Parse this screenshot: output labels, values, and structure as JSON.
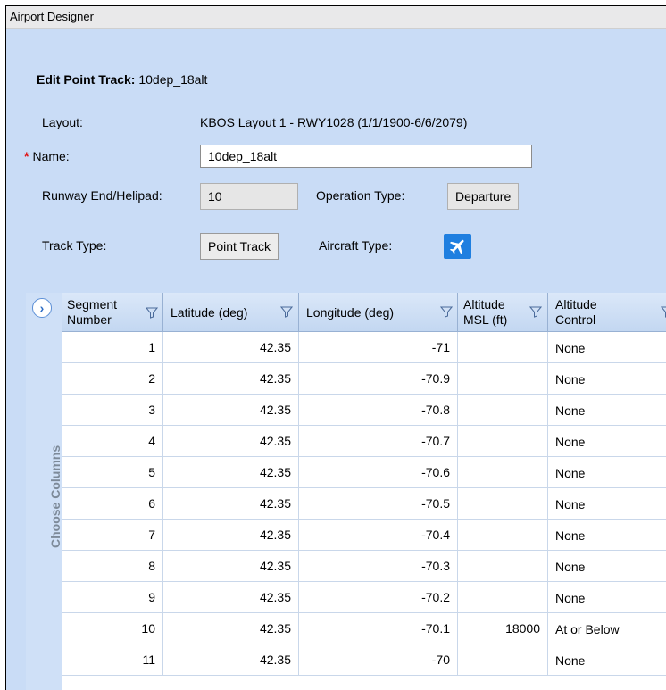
{
  "window": {
    "title": "Airport Designer"
  },
  "form": {
    "heading_label": "Edit Point Track:",
    "heading_value": "10dep_18alt",
    "layout_label": "Layout:",
    "layout_value": "KBOS Layout 1 - RWY1028 (1/1/1900-6/6/2079)",
    "required_marker": "*",
    "name_label": "Name:",
    "name_value": "10dep_18alt",
    "runway_label": "Runway End/Helipad:",
    "runway_value": "10",
    "operation_label": "Operation Type:",
    "operation_value": "Departure",
    "track_type_label": "Track Type:",
    "track_type_value": "Point Track",
    "aircraft_type_label": "Aircraft Type:",
    "aircraft_icon": "airplane-icon"
  },
  "side_panel": {
    "expand_icon": "chevron-right-icon",
    "choose_columns_label": "Choose Columns"
  },
  "grid": {
    "columns": [
      {
        "line1": "Segment",
        "line2": "Number"
      },
      {
        "line1": "Latitude (deg)",
        "line2": ""
      },
      {
        "line1": "Longitude (deg)",
        "line2": ""
      },
      {
        "line1": "Altitude",
        "line2": "MSL (ft)"
      },
      {
        "line1": "Altitude",
        "line2": "Control"
      }
    ],
    "rows": [
      {
        "segment": "1",
        "lat": "42.35",
        "lon": "-71",
        "alt": "",
        "control": "None"
      },
      {
        "segment": "2",
        "lat": "42.35",
        "lon": "-70.9",
        "alt": "",
        "control": "None"
      },
      {
        "segment": "3",
        "lat": "42.35",
        "lon": "-70.8",
        "alt": "",
        "control": "None"
      },
      {
        "segment": "4",
        "lat": "42.35",
        "lon": "-70.7",
        "alt": "",
        "control": "None"
      },
      {
        "segment": "5",
        "lat": "42.35",
        "lon": "-70.6",
        "alt": "",
        "control": "None"
      },
      {
        "segment": "6",
        "lat": "42.35",
        "lon": "-70.5",
        "alt": "",
        "control": "None"
      },
      {
        "segment": "7",
        "lat": "42.35",
        "lon": "-70.4",
        "alt": "",
        "control": "None"
      },
      {
        "segment": "8",
        "lat": "42.35",
        "lon": "-70.3",
        "alt": "",
        "control": "None"
      },
      {
        "segment": "9",
        "lat": "42.35",
        "lon": "-70.2",
        "alt": "",
        "control": "None"
      },
      {
        "segment": "10",
        "lat": "42.35",
        "lon": "-70.1",
        "alt": "18000",
        "control": "At or Below"
      },
      {
        "segment": "11",
        "lat": "42.35",
        "lon": "-70",
        "alt": "",
        "control": "None"
      }
    ]
  },
  "colors": {
    "panel_bg": "#c9dcf6",
    "accent": "#1f7fe0",
    "required": "#e01010"
  }
}
